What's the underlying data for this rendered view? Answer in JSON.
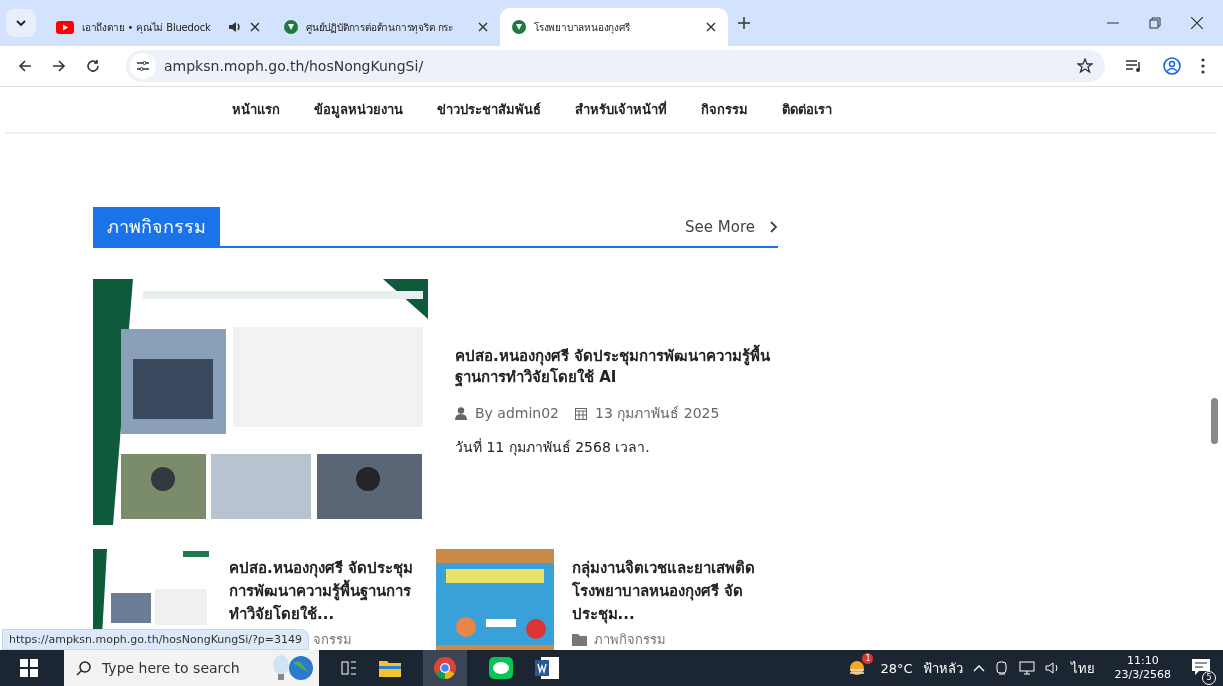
{
  "browser": {
    "tabs": [
      {
        "title": "เอาถึงตาย • คุณไม่ Bluedock",
        "kind": "youtube",
        "audio": true,
        "selected": false
      },
      {
        "title": "ศูนย์ปฏิบัติการต่อต้านการทุจริต กระ",
        "kind": "site",
        "audio": false,
        "selected": false
      },
      {
        "title": "โรงพยาบาลหนองกุงศรี",
        "kind": "site",
        "audio": false,
        "selected": true
      }
    ],
    "url": "ampksn.moph.go.th/hosNongKungSi/"
  },
  "nav": [
    "หน้าแรก",
    "ข้อมูลหน่วยงาน",
    "ข่าวประชาสัมพันธ์",
    "สำหรับเจ้าหน้าที่",
    "กิจกรรม",
    "ติดต่อเรา"
  ],
  "section": {
    "title": "ภาพกิจกรรม",
    "see_more": "See More"
  },
  "featured": {
    "title": "คปสอ.หนองกุงศรี จัดประชุมการพัฒนาความรู้พื้นฐานการทำวิจัยโดยใช้ AI",
    "author": "By admin02",
    "date": "13 กุมภาพันธ์ 2025",
    "excerpt": "วันที่ 11 กุมภาพันธ์ 2568 เวลา."
  },
  "cards": [
    {
      "title": "คปสอ.หนองกุงศรี จัดประชุมการพัฒนาความรู้พื้นฐานการทำวิจัยโดยใช้...",
      "category": "จกรรม",
      "kind": "poster"
    },
    {
      "title": "กลุ่มงานจิตเวชและยาเสพติด โรงพยาบาลหนองกุงศรี จัดประชุม...",
      "category": "ภาพกิจกรรม",
      "kind": "banner"
    }
  ],
  "status_url": "https://ampksn.moph.go.th/hosNongKungSi/?p=3149",
  "taskbar": {
    "search_placeholder": "Type here to search",
    "weather_badge": "1",
    "temperature": "28°C",
    "weather": "ฟ้าหลัว",
    "language": "ไทย",
    "time": "11:10",
    "date": "23/3/2568",
    "notifications": "5"
  }
}
